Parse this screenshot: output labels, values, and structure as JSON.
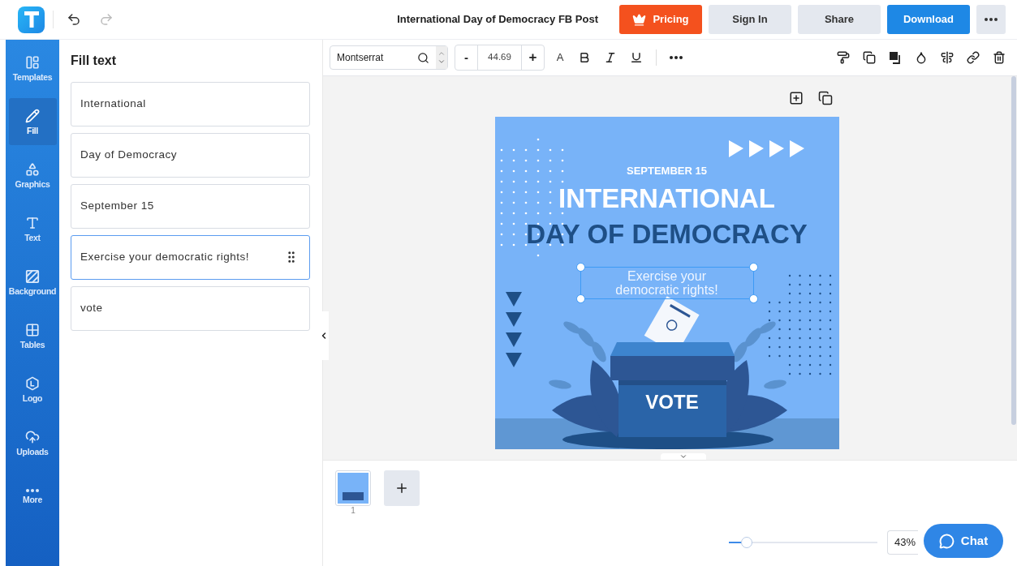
{
  "header": {
    "title": "International Day of Democracy FB Post",
    "buttons": [
      {
        "label": "Pricing",
        "kind": "pricing"
      },
      {
        "label": "Sign In",
        "kind": "plain"
      },
      {
        "label": "Share",
        "kind": "plain"
      },
      {
        "label": "Download",
        "kind": "primary"
      }
    ]
  },
  "sidebar": {
    "items": [
      {
        "label": "Templates",
        "selected": false
      },
      {
        "label": "Fill",
        "selected": true
      },
      {
        "label": "Graphics",
        "selected": false
      },
      {
        "label": "Text",
        "selected": false
      },
      {
        "label": "Background",
        "selected": false
      },
      {
        "label": "Tables",
        "selected": false
      },
      {
        "label": "Logo",
        "selected": false
      },
      {
        "label": "Uploads",
        "selected": false
      },
      {
        "label": "More",
        "selected": false
      }
    ]
  },
  "fill_panel": {
    "title": "Fill text",
    "fields": [
      {
        "value": "International",
        "selected": false
      },
      {
        "value": "Day of Democracy",
        "selected": false
      },
      {
        "value": "September 15",
        "selected": false
      },
      {
        "value": "Exercise your democratic rights!",
        "selected": true
      },
      {
        "value": "vote",
        "selected": false
      }
    ]
  },
  "toolbar": {
    "font": "Montserrat",
    "size_decrease": "-",
    "font_size": "44.69",
    "size_increase": "+",
    "font_color": "A"
  },
  "poster": {
    "date": "SEPTEMBER 15",
    "headline_1": "INTERNATIONAL",
    "headline_2": "DAY OF DEMOCRACY",
    "tagline": "Exercise your democratic rights!",
    "box_label": "VOTE"
  },
  "pages": [
    {
      "number": "1",
      "selected": true
    }
  ],
  "zoom": {
    "level": 0.12,
    "value": "43%"
  },
  "chat": {
    "label": "Chat"
  }
}
